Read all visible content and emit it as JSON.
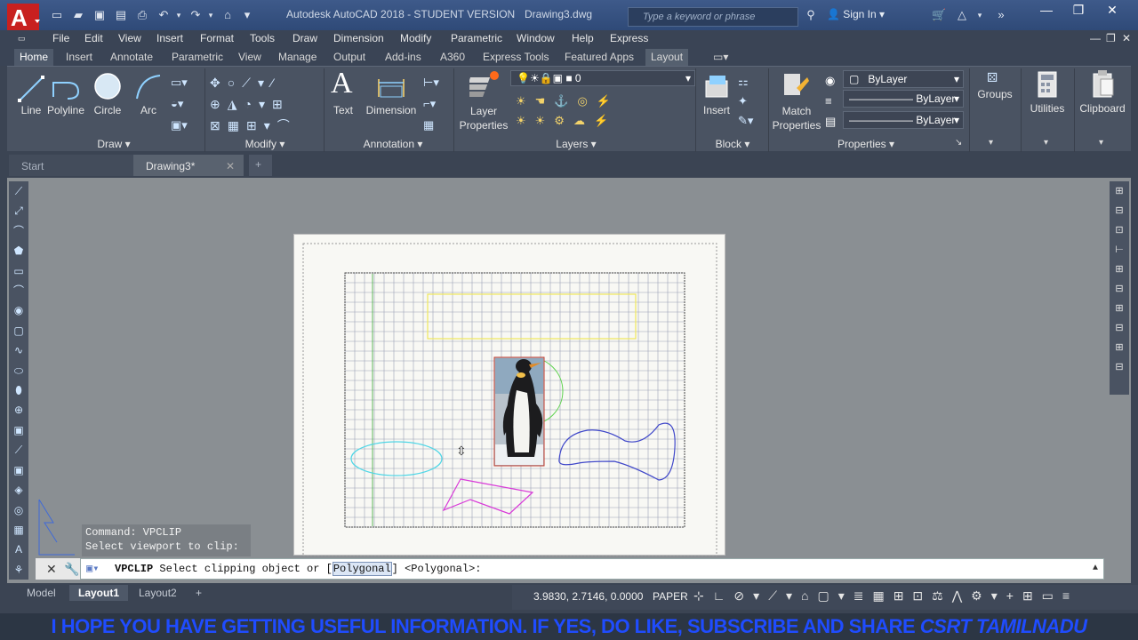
{
  "title_bar": {
    "app_title": "Autodesk AutoCAD 2018 - STUDENT VERSION",
    "file_name": "Drawing3.dwg",
    "search_placeholder": "Type a keyword or phrase",
    "sign_in": "Sign In"
  },
  "menu": [
    "File",
    "Edit",
    "View",
    "Insert",
    "Format",
    "Tools",
    "Draw",
    "Dimension",
    "Modify",
    "Parametric",
    "Window",
    "Help",
    "Express"
  ],
  "ribbon_tabs": [
    "Home",
    "Insert",
    "Annotate",
    "Parametric",
    "View",
    "Manage",
    "Output",
    "Add-ins",
    "A360",
    "Express Tools",
    "Featured Apps",
    "Layout"
  ],
  "ribbon_active_tab": "Home",
  "ribbon_tools": {
    "line": "Line",
    "polyline": "Polyline",
    "circle": "Circle",
    "arc": "Arc",
    "text": "Text",
    "dimension": "Dimension",
    "layer_properties_1": "Layer",
    "layer_properties_2": "Properties",
    "insert": "Insert",
    "match_properties_1": "Match",
    "match_properties_2": "Properties",
    "groups": "Groups",
    "utilities": "Utilities",
    "clipboard": "Clipboard",
    "layer_current": "0",
    "color_bylayer": "ByLayer",
    "linetype_bylayer": "ByLayer",
    "lineweight_bylayer": "ByLayer"
  },
  "ribbon_panels": {
    "draw": "Draw",
    "modify": "Modify",
    "annotation": "Annotation",
    "layers": "Layers",
    "block": "Block",
    "properties": "Properties"
  },
  "document_tabs": [
    "Start",
    "Drawing3*"
  ],
  "command_history": [
    "Command: VPCLIP",
    "Select viewport to clip:"
  ],
  "command_prompt": {
    "cmd": "VPCLIP",
    "text": "Select clipping object or [",
    "option": "Polygonal",
    "tail": "] <Polygonal>:"
  },
  "layout_tabs": [
    "Model",
    "Layout1",
    "Layout2"
  ],
  "layout_active": "Layout1",
  "status": {
    "coordinates": "3.9830, 2.7146, 0.0000",
    "space": "PAPER"
  },
  "banner": {
    "text": "I HOPE YOU HAVE GETTING USEFUL INFORMATION. IF YES, DO LIKE, SUBSCRIBE AND SHARE ",
    "brand": "CSRT TAMILNADU"
  },
  "colors": {
    "title_bg": "#2f4a78",
    "ribbon_bg": "#4a5362",
    "workspace_bg": "#8a8f93",
    "paper_bg": "#f8f8f4",
    "banner_text": "#1f4cff"
  }
}
